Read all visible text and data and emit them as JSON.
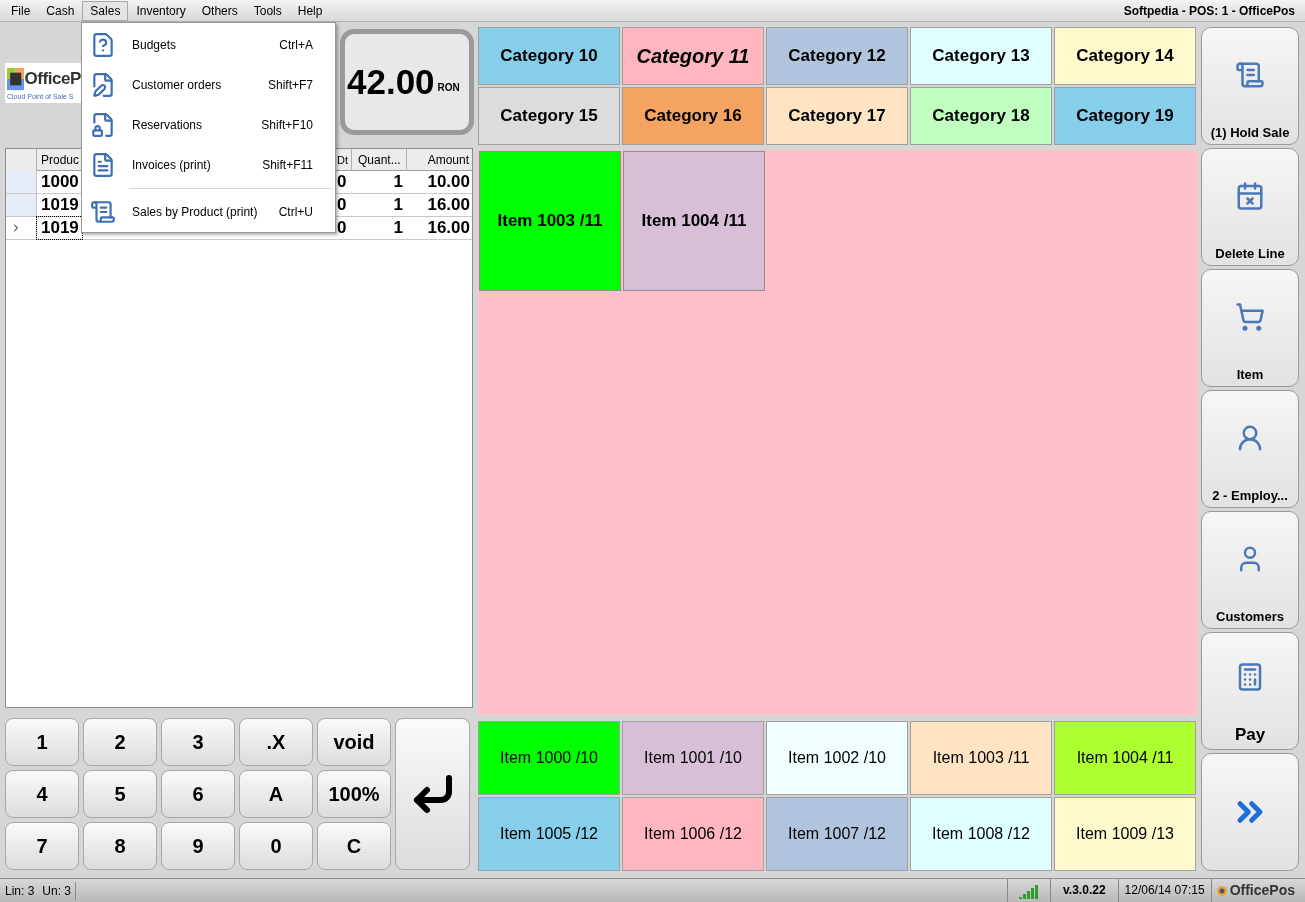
{
  "menu_bar": {
    "items": [
      {
        "label": "File",
        "selected": false
      },
      {
        "label": "Cash",
        "selected": false
      },
      {
        "label": "Sales",
        "selected": true
      },
      {
        "label": "Inventory",
        "selected": false
      },
      {
        "label": "Others",
        "selected": false
      },
      {
        "label": "Tools",
        "selected": false
      },
      {
        "label": "Help",
        "selected": false
      }
    ],
    "title": "Softpedia - POS: 1 - OfficePos"
  },
  "sales_menu": {
    "items": [
      {
        "kind": "item",
        "label": "Budgets",
        "shortcut": "Ctrl+A"
      },
      {
        "kind": "item",
        "label": "Customer orders",
        "shortcut": "Shift+F7"
      },
      {
        "kind": "item",
        "label": "Reservations",
        "shortcut": "Shift+F10"
      },
      {
        "kind": "item",
        "label": "Invoices (print)",
        "shortcut": "Shift+F11"
      },
      {
        "kind": "separator"
      },
      {
        "kind": "item",
        "label": "Sales by Product (print)",
        "shortcut": "Ctrl+U"
      }
    ]
  },
  "logo": {
    "name": "OfficeP",
    "tagline": "Cloud Point of Sale S"
  },
  "total": {
    "amount": "42.00",
    "currency": "RON"
  },
  "table": {
    "columns": [
      "Produc",
      "Dt",
      "Quant...",
      "Amount"
    ],
    "rows": [
      {
        "product": "1000",
        "dt": "0",
        "quantity": "1",
        "amount": "10.00",
        "current": false
      },
      {
        "product": "1019",
        "dt": "0",
        "quantity": "1",
        "amount": "16.00",
        "current": false
      },
      {
        "product": "1019",
        "dt": "0",
        "quantity": "1",
        "amount": "16.00",
        "current": true
      }
    ]
  },
  "keypad": {
    "keys": [
      "1",
      "2",
      "3",
      ".X",
      "void",
      "4",
      "5",
      "6",
      "A",
      "100%",
      "7",
      "8",
      "9",
      "0",
      "C"
    ]
  },
  "categories": [
    {
      "label": "Category 10",
      "color": "#87ceeb",
      "selected": false
    },
    {
      "label": "Category 11",
      "color": "#ffb6c1",
      "selected": true
    },
    {
      "label": "Category 12",
      "color": "#b0c4de",
      "selected": false
    },
    {
      "label": "Category 13",
      "color": "#e0ffff",
      "selected": false
    },
    {
      "label": "Category 14",
      "color": "#fffacd",
      "selected": false
    },
    {
      "label": "Category 15",
      "color": "#dcdcdc",
      "selected": false
    },
    {
      "label": "Category 16",
      "color": "#f4a460",
      "selected": false
    },
    {
      "label": "Category 17",
      "color": "#ffe4c4",
      "selected": false
    },
    {
      "label": "Category 18",
      "color": "#c0ffc0",
      "selected": false
    },
    {
      "label": "Category 19",
      "color": "#87ceeb",
      "selected": false
    }
  ],
  "category_items": [
    {
      "label": "Item 1003 /11",
      "color": "#00ff00"
    },
    {
      "label": "Item 1004 /11",
      "color": "#d8bfd8"
    }
  ],
  "quick_items": [
    {
      "label": "Item 1000 /10",
      "color": "#00ff00"
    },
    {
      "label": "Item 1001 /10",
      "color": "#d8bfd8"
    },
    {
      "label": "Item 1002 /10",
      "color": "#f0ffff"
    },
    {
      "label": "Item 1003 /11",
      "color": "#ffe4c4"
    },
    {
      "label": "Item 1004 /11",
      "color": "#adff2f"
    },
    {
      "label": "Item 1005 /12",
      "color": "#87ceeb"
    },
    {
      "label": "Item 1006 /12",
      "color": "#ffb6c1"
    },
    {
      "label": "Item 1007 /12",
      "color": "#b0c4de"
    },
    {
      "label": "Item 1008 /12",
      "color": "#e0ffff"
    },
    {
      "label": "Item 1009 /13",
      "color": "#fffacd"
    }
  ],
  "actions": [
    {
      "label": "(1) Hold Sale"
    },
    {
      "label": "Delete Line"
    },
    {
      "label": "Item"
    },
    {
      "label": "2 - Employ..."
    },
    {
      "label": "Customers"
    },
    {
      "label": "Pay"
    }
  ],
  "status_bar": {
    "lines": "Lin: 3",
    "units": "Un: 3",
    "version": "v.3.0.22",
    "datetime": "12/06/14 07:15",
    "brand": "OfficePos"
  }
}
